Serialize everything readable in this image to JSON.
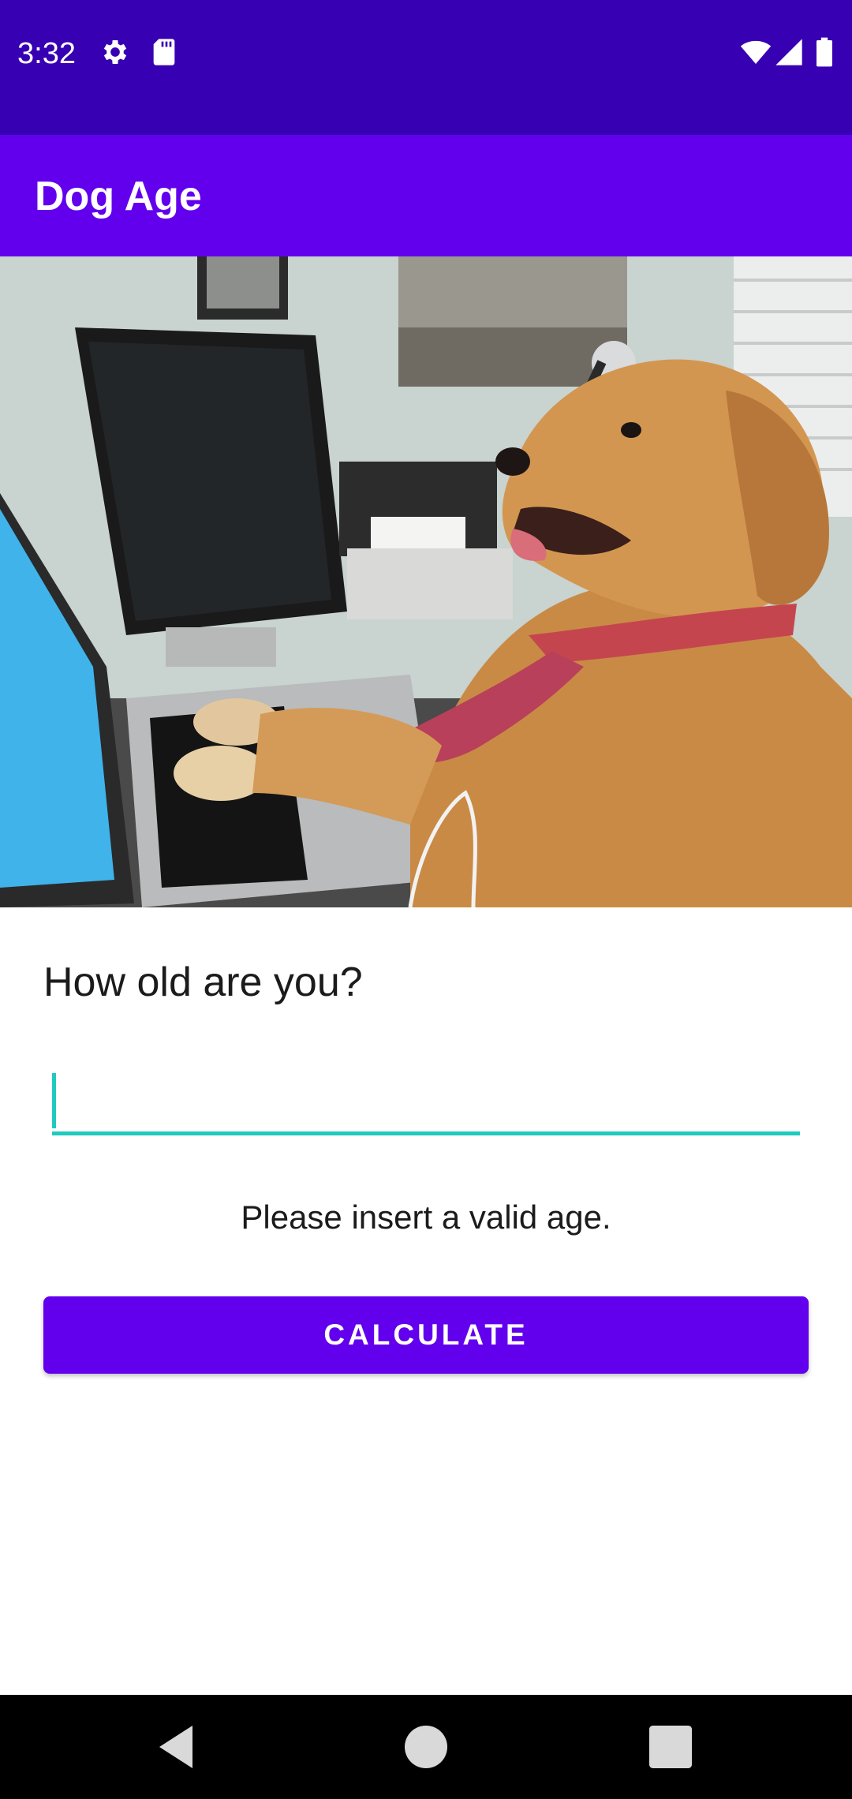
{
  "status_bar": {
    "time": "3:32",
    "icons": [
      "settings-icon",
      "sd-card-icon",
      "wifi-icon",
      "signal-icon",
      "battery-icon"
    ]
  },
  "app_bar": {
    "title": "Dog Age"
  },
  "hero_image": {
    "description_icon": "dog-at-computer-photo"
  },
  "form": {
    "question": "How old are you?",
    "age_input_value": "",
    "message": "Please insert a valid age.",
    "calculate_label": "CALCULATE"
  },
  "nav_bar": {
    "icons": [
      "back-icon",
      "home-icon",
      "recents-icon"
    ]
  },
  "colors": {
    "status_bar": "#3700B3",
    "primary": "#6200EE",
    "accent": "#1ECBBE",
    "nav_bar": "#000000"
  }
}
